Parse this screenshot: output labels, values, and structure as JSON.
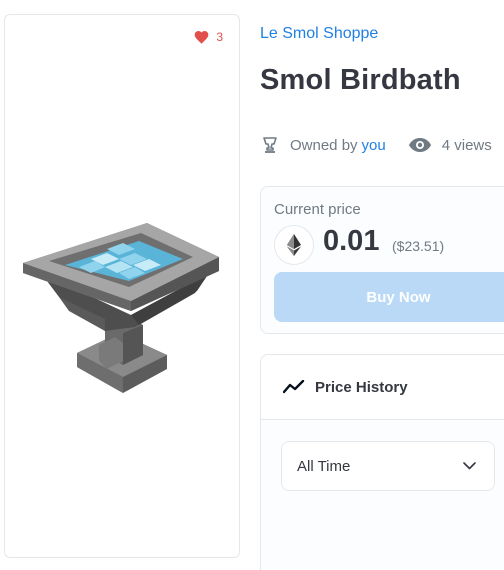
{
  "asset_card": {
    "favorites_count": "3",
    "image_icon": "birdbath-pixel-art"
  },
  "collection": {
    "name": "Le Smol Shoppe"
  },
  "asset": {
    "title": "Smol Birdbath"
  },
  "meta": {
    "owned_by_label": "Owned by",
    "owner": "you",
    "views_count": "4 views",
    "owner_icon": "trophy-icon",
    "views_icon": "eye-icon"
  },
  "price": {
    "label": "Current price",
    "value": "0.01",
    "usd": "($23.51)",
    "currency_icon": "ethereum-icon",
    "buy_label": "Buy Now"
  },
  "history": {
    "title": "Price History",
    "range": "All Time"
  },
  "colors": {
    "accent": "#2081e2",
    "heart": "#e2504c",
    "buy_button_disabled": "#b9d9f7",
    "text_primary": "#353840",
    "text_secondary": "#707a83"
  }
}
